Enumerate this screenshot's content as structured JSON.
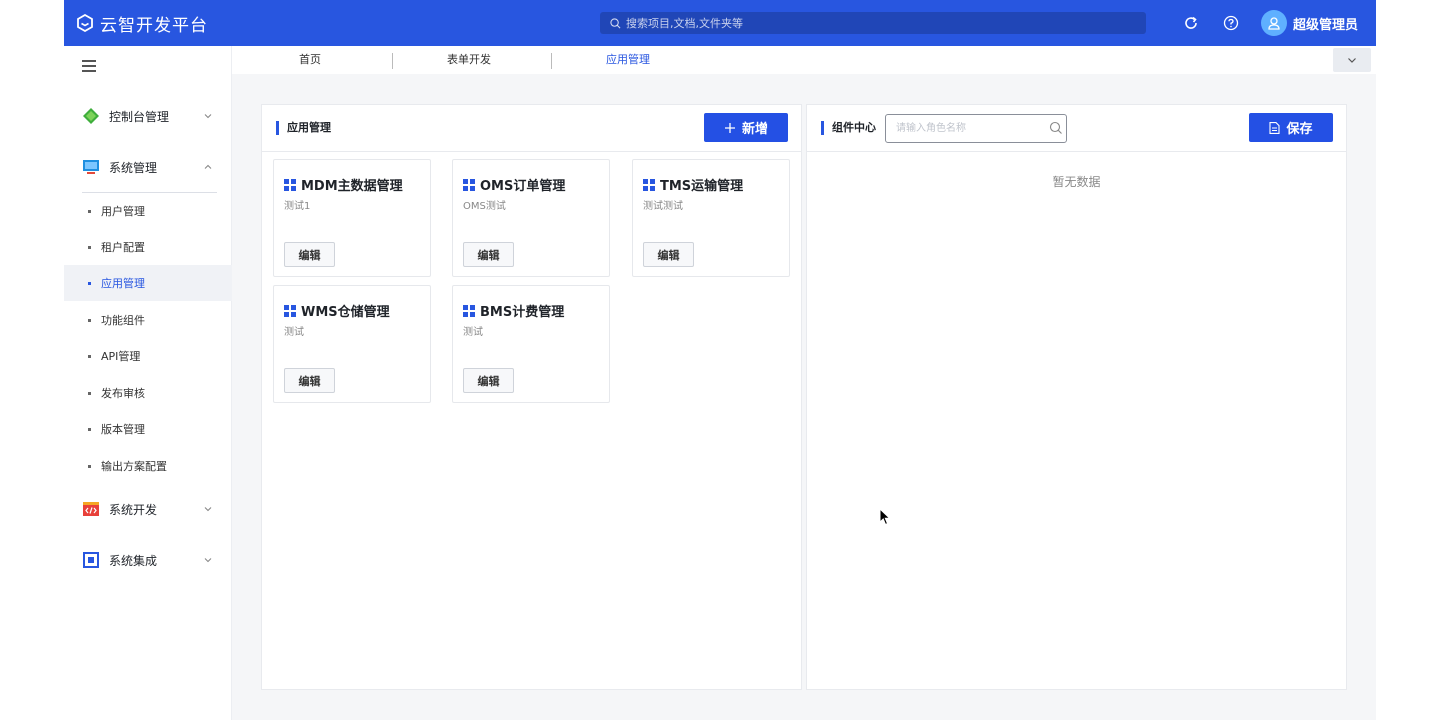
{
  "header": {
    "logo_text": "云智开发平台",
    "search_placeholder": "搜索项目,文档,文件夹等",
    "username": "超级管理员"
  },
  "sidebar": {
    "groups": [
      {
        "label": "控制台管理",
        "icon": "leaf-icon",
        "expanded": false
      },
      {
        "label": "系统管理",
        "icon": "monitor-icon",
        "expanded": true
      },
      {
        "label": "系统开发",
        "icon": "code-icon",
        "expanded": false
      },
      {
        "label": "系统集成",
        "icon": "chip-icon",
        "expanded": false
      }
    ],
    "sub_items": [
      "用户管理",
      "租户配置",
      "应用管理",
      "功能组件",
      "API管理",
      "发布审核",
      "版本管理",
      "输出方案配置"
    ],
    "active_sub_item": "应用管理"
  },
  "tabs": [
    "首页",
    "表单开发",
    "应用管理"
  ],
  "active_tab": "应用管理",
  "app_panel": {
    "title": "应用管理",
    "add_button": "新增",
    "cards": [
      {
        "title": "MDM主数据管理",
        "desc": "测试1",
        "edit": "编辑"
      },
      {
        "title": "OMS订单管理",
        "desc": "OMS测试",
        "edit": "编辑"
      },
      {
        "title": "TMS运输管理",
        "desc": "测试测试",
        "edit": "编辑"
      },
      {
        "title": "WMS仓储管理",
        "desc": "测试",
        "edit": "编辑"
      },
      {
        "title": "BMS计费管理",
        "desc": "测试",
        "edit": "编辑"
      }
    ]
  },
  "component_panel": {
    "title": "组件中心",
    "search_placeholder": "请输入角色名称",
    "save_button": "保存",
    "empty_text": "暂无数据"
  },
  "colors": {
    "primary": "#2856e0",
    "header_bg": "#2856e0"
  }
}
